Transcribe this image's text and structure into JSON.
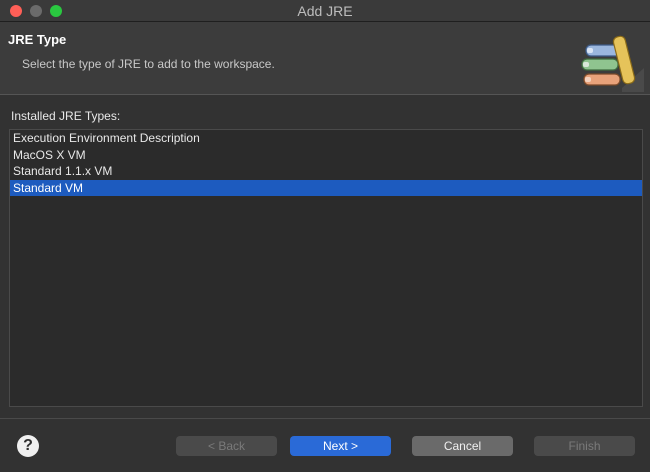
{
  "window": {
    "title": "Add JRE"
  },
  "banner": {
    "title": "JRE Type",
    "subtitle": "Select the type of JRE to add to the workspace.",
    "icon": "jar-library-icon"
  },
  "list": {
    "label": "Installed JRE Types:",
    "items": [
      "Execution Environment Description",
      "MacOS X VM",
      "Standard 1.1.x VM",
      "Standard VM"
    ],
    "selected": "Standard VM"
  },
  "footer": {
    "help_label": "?",
    "back_label": "< Back",
    "next_label": "Next >",
    "cancel_label": "Cancel",
    "finish_label": "Finish"
  },
  "colors": {
    "selection": "#1d5bbf",
    "primary_button": "#2a6ad7",
    "close_light": "#ff5f57",
    "zoom_light": "#2ac840"
  }
}
